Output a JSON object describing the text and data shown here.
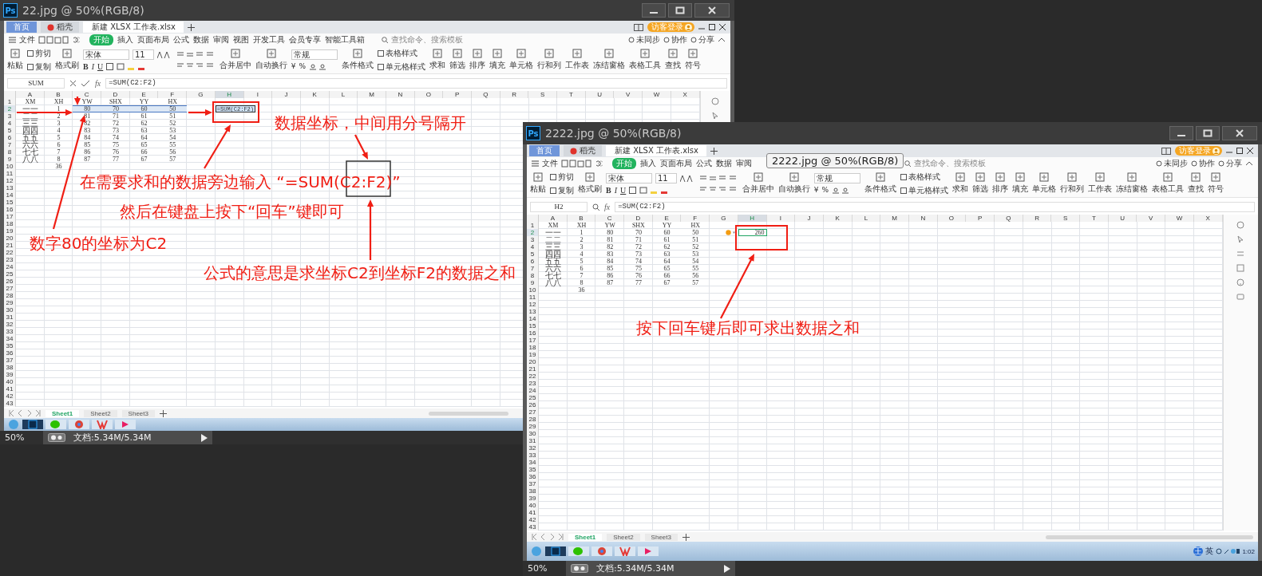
{
  "windows": [
    {
      "logo": "Ps",
      "title": "22.jpg @ 50%(RGB/8)",
      "zoom": "50%",
      "doc_info": "文档:5.34M/5.34M",
      "app": {
        "tabs": [
          {
            "label": "首页",
            "kind": "home",
            "selected": false
          },
          {
            "label": "稻壳",
            "kind": "docer",
            "selected": false
          },
          {
            "label": "新建 XLSX 工作表.xlsx",
            "kind": "file",
            "selected": true
          }
        ],
        "login": "访客登录",
        "file_menu": "文件",
        "menu": [
          {
            "label": "开始",
            "selected": true
          },
          {
            "label": "插入",
            "selected": false
          },
          {
            "label": "页面布局",
            "selected": false
          },
          {
            "label": "公式",
            "selected": false
          },
          {
            "label": "数据",
            "selected": false
          },
          {
            "label": "审阅",
            "selected": false
          },
          {
            "label": "视图",
            "selected": false
          },
          {
            "label": "开发工具",
            "selected": false
          },
          {
            "label": "会员专享",
            "selected": false
          },
          {
            "label": "智能工具箱",
            "selected": false
          }
        ],
        "search_placeholder": "查找命令、搜索模板",
        "actions": [
          "未同步",
          "协作",
          "分享"
        ],
        "ribbon": [
          {
            "kind": "big",
            "label": "粘贴"
          },
          {
            "kind": "pair",
            "labels": [
              "剪切",
              "复制"
            ]
          },
          {
            "kind": "big",
            "label": "格式刷"
          },
          {
            "kind": "font",
            "face": "宋体",
            "size": "11",
            "styles": [
              "B",
              "I",
              "U"
            ]
          },
          {
            "kind": "align"
          },
          {
            "kind": "big",
            "label": "合并居中"
          },
          {
            "kind": "big",
            "label": "自动换行"
          },
          {
            "kind": "number",
            "format": "常规",
            "symbols": [
              "¥",
              "%"
            ]
          },
          {
            "kind": "big",
            "label": "条件格式"
          },
          {
            "kind": "pair",
            "labels": [
              "表格样式",
              "单元格样式"
            ]
          },
          {
            "kind": "big",
            "label": "求和"
          },
          {
            "kind": "big",
            "label": "筛选"
          },
          {
            "kind": "big",
            "label": "排序"
          },
          {
            "kind": "big",
            "label": "填充"
          },
          {
            "kind": "big",
            "label": "单元格"
          },
          {
            "kind": "big",
            "label": "行和列"
          },
          {
            "kind": "big",
            "label": "工作表"
          },
          {
            "kind": "big",
            "label": "冻结窗格"
          },
          {
            "kind": "big",
            "label": "表格工具"
          },
          {
            "kind": "big",
            "label": "查找"
          },
          {
            "kind": "big",
            "label": "符号"
          }
        ],
        "formula_bar": {
          "kind": "editing",
          "name_box": "SUM",
          "fx": "fx",
          "formula": "=SUM(C2:F2)"
        },
        "columns": [
          "A",
          "B",
          "C",
          "D",
          "E",
          "F",
          "G",
          "H",
          "I",
          "J",
          "K",
          "L",
          "M",
          "N",
          "O",
          "P",
          "Q",
          "R",
          "S",
          "T",
          "U",
          "V",
          "W",
          "X"
        ],
        "rows": [
          {
            "number": "1",
            "cells": {
              "A": "XM",
              "B": "XH",
              "C": "YW",
              "D": "SHX",
              "E": "YY",
              "F": "HX"
            }
          },
          {
            "number": "2",
            "cells": {
              "A": "一一",
              "B": "1",
              "C": {
                "text": "80",
                "selected": true
              },
              "D": {
                "text": "70",
                "selected": true
              },
              "E": {
                "text": "60",
                "selected": true
              },
              "F": {
                "text": "50",
                "selected": true
              },
              "H": {
                "text": "=SUM(C2:F2)",
                "kind": "editing"
              }
            }
          },
          {
            "number": "3",
            "cells": {
              "A": "二二",
              "B": "2",
              "C": "81",
              "D": "71",
              "E": "61",
              "F": "51"
            }
          },
          {
            "number": "4",
            "cells": {
              "A": "三三",
              "B": "3",
              "C": "82",
              "D": "72",
              "E": "62",
              "F": "52"
            }
          },
          {
            "number": "5",
            "cells": {
              "A": "四四",
              "B": "4",
              "C": "83",
              "D": "73",
              "E": "63",
              "F": "53"
            }
          },
          {
            "number": "6",
            "cells": {
              "A": "五五",
              "B": "5",
              "C": "84",
              "D": "74",
              "E": "64",
              "F": "54"
            }
          },
          {
            "number": "7",
            "cells": {
              "A": "六六",
              "B": "6",
              "C": "85",
              "D": "75",
              "E": "65",
              "F": "55"
            }
          },
          {
            "number": "8",
            "cells": {
              "A": "七七",
              "B": "7",
              "C": "86",
              "D": "76",
              "E": "66",
              "F": "56"
            }
          },
          {
            "number": "9",
            "cells": {
              "A": "八八",
              "B": "8",
              "C": "87",
              "D": "77",
              "E": "67",
              "F": "57"
            }
          },
          {
            "number": "10",
            "cells": {
              "B": "36"
            }
          },
          {
            "number": "11"
          },
          {
            "number": "12"
          },
          {
            "number": "13"
          },
          {
            "number": "14"
          },
          {
            "number": "15"
          },
          {
            "number": "16"
          },
          {
            "number": "17"
          },
          {
            "number": "18"
          },
          {
            "number": "19"
          },
          {
            "number": "20"
          },
          {
            "number": "21"
          },
          {
            "number": "22"
          },
          {
            "number": "23"
          },
          {
            "number": "24"
          },
          {
            "number": "25"
          },
          {
            "number": "26"
          },
          {
            "number": "27"
          },
          {
            "number": "28"
          },
          {
            "number": "29"
          },
          {
            "number": "30"
          },
          {
            "number": "31"
          },
          {
            "number": "32"
          },
          {
            "number": "33"
          },
          {
            "number": "34"
          },
          {
            "number": "35"
          },
          {
            "number": "36"
          },
          {
            "number": "37"
          },
          {
            "number": "38"
          },
          {
            "number": "39"
          },
          {
            "number": "40"
          },
          {
            "number": "41"
          },
          {
            "number": "42"
          },
          {
            "number": "43"
          }
        ],
        "sheets": [
          {
            "label": "Sheet1",
            "selected": true
          },
          {
            "label": "Sheet2",
            "selected": false
          },
          {
            "label": "Sheet3",
            "selected": false
          }
        ]
      }
    },
    {
      "logo": "Ps",
      "title": "2222.jpg @ 50%(RGB/8)",
      "zoom": "50%",
      "doc_info": "文档:5.34M/5.34M",
      "app": {
        "tabs": [
          {
            "label": "首页",
            "kind": "home",
            "selected": false
          },
          {
            "label": "稻壳",
            "kind": "docer",
            "selected": false
          },
          {
            "label": "新建 XLSX 工作表.xlsx",
            "kind": "file",
            "selected": true
          }
        ],
        "login": "访客登录",
        "file_menu": "文件",
        "menu": [
          {
            "label": "开始",
            "selected": true
          },
          {
            "label": "插入",
            "selected": false
          },
          {
            "label": "页面布局",
            "selected": false
          },
          {
            "label": "公式",
            "selected": false
          },
          {
            "label": "数据",
            "selected": false
          },
          {
            "label": "审阅",
            "selected": false
          }
        ],
        "search_placeholder": "查找命令、搜索模板",
        "actions": [
          "未同步",
          "协作",
          "分享"
        ],
        "ribbon": [
          {
            "kind": "big",
            "label": "粘贴"
          },
          {
            "kind": "pair",
            "labels": [
              "剪切",
              "复制"
            ]
          },
          {
            "kind": "big",
            "label": "格式刷"
          },
          {
            "kind": "font",
            "face": "宋体",
            "size": "11",
            "styles": [
              "B",
              "I",
              "U"
            ]
          },
          {
            "kind": "align"
          },
          {
            "kind": "big",
            "label": "合并居中"
          },
          {
            "kind": "big",
            "label": "自动换行"
          },
          {
            "kind": "number",
            "format": "常规",
            "symbols": [
              "¥",
              "%"
            ]
          },
          {
            "kind": "big",
            "label": "条件格式"
          },
          {
            "kind": "pair",
            "labels": [
              "表格样式",
              "单元格样式"
            ]
          },
          {
            "kind": "big",
            "label": "求和"
          },
          {
            "kind": "big",
            "label": "筛选"
          },
          {
            "kind": "big",
            "label": "排序"
          },
          {
            "kind": "big",
            "label": "填充"
          },
          {
            "kind": "big",
            "label": "单元格"
          },
          {
            "kind": "big",
            "label": "行和列"
          },
          {
            "kind": "big",
            "label": "工作表"
          },
          {
            "kind": "big",
            "label": "冻结窗格"
          },
          {
            "kind": "big",
            "label": "表格工具"
          },
          {
            "kind": "big",
            "label": "查找"
          },
          {
            "kind": "big",
            "label": "符号"
          }
        ],
        "formula_bar": {
          "kind": "idle",
          "name_box": "H2",
          "fx": "fx",
          "formula": "=SUM(C2:F2)"
        },
        "columns": [
          "A",
          "B",
          "C",
          "D",
          "E",
          "F",
          "G",
          "H",
          "I",
          "J",
          "K",
          "L",
          "M",
          "N",
          "O",
          "P",
          "Q",
          "R",
          "S",
          "T",
          "U",
          "V",
          "W",
          "X"
        ],
        "rows": [
          {
            "number": "1",
            "cells": {
              "A": "XM",
              "B": "XH",
              "C": "YW",
              "D": "SHX",
              "E": "YY",
              "F": "HX"
            }
          },
          {
            "number": "2",
            "cells": {
              "A": "一一",
              "B": "1",
              "C": "80",
              "D": "70",
              "E": "60",
              "F": "50",
              "H": {
                "text": "260",
                "kind": "result"
              }
            }
          },
          {
            "number": "3",
            "cells": {
              "A": "二二",
              "B": "2",
              "C": "81",
              "D": "71",
              "E": "61",
              "F": "51"
            }
          },
          {
            "number": "4",
            "cells": {
              "A": "三三",
              "B": "3",
              "C": "82",
              "D": "72",
              "E": "62",
              "F": "52"
            }
          },
          {
            "number": "5",
            "cells": {
              "A": "四四",
              "B": "4",
              "C": "83",
              "D": "73",
              "E": "63",
              "F": "53"
            }
          },
          {
            "number": "6",
            "cells": {
              "A": "五五",
              "B": "5",
              "C": "84",
              "D": "74",
              "E": "64",
              "F": "54"
            }
          },
          {
            "number": "7",
            "cells": {
              "A": "六六",
              "B": "6",
              "C": "85",
              "D": "75",
              "E": "65",
              "F": "55"
            }
          },
          {
            "number": "8",
            "cells": {
              "A": "七七",
              "B": "7",
              "C": "86",
              "D": "76",
              "E": "66",
              "F": "56"
            }
          },
          {
            "number": "9",
            "cells": {
              "A": "八八",
              "B": "8",
              "C": "87",
              "D": "77",
              "E": "67",
              "F": "57"
            }
          },
          {
            "number": "10",
            "cells": {
              "B": "36"
            }
          },
          {
            "number": "11"
          },
          {
            "number": "12"
          },
          {
            "number": "13"
          },
          {
            "number": "14"
          },
          {
            "number": "15"
          },
          {
            "number": "16"
          },
          {
            "number": "17"
          },
          {
            "number": "18"
          },
          {
            "number": "19"
          },
          {
            "number": "20"
          },
          {
            "number": "21"
          },
          {
            "number": "22"
          },
          {
            "number": "23"
          },
          {
            "number": "24"
          },
          {
            "number": "25"
          },
          {
            "number": "26"
          },
          {
            "number": "27"
          },
          {
            "number": "28"
          },
          {
            "number": "29"
          },
          {
            "number": "30"
          },
          {
            "number": "31"
          },
          {
            "number": "32"
          },
          {
            "number": "33"
          },
          {
            "number": "34"
          },
          {
            "number": "35"
          },
          {
            "number": "36"
          },
          {
            "number": "37"
          },
          {
            "number": "38"
          },
          {
            "number": "39"
          },
          {
            "number": "40"
          },
          {
            "number": "41"
          },
          {
            "number": "42"
          },
          {
            "number": "43"
          }
        ],
        "sheets": [
          {
            "label": "Sheet1",
            "selected": true
          },
          {
            "label": "Sheet2",
            "selected": false
          },
          {
            "label": "Sheet3",
            "selected": false
          }
        ],
        "tray": [
          "王",
          "英",
          "1:02"
        ]
      }
    }
  ],
  "annotations": [
    {
      "kind": "note",
      "text": "数据坐标，中间用分号隔开"
    },
    {
      "kind": "note",
      "text": "在需要求和的数据旁边输入 “=SUM(C2:F2)”"
    },
    {
      "kind": "note",
      "text": "然后在键盘上按下“回车”键即可"
    },
    {
      "kind": "note",
      "text": "数字80的坐标为C2"
    },
    {
      "kind": "note",
      "text": "公式的意思是求坐标C2到坐标F2的数据之和"
    },
    {
      "kind": "note",
      "text": "按下回车键后即可求出数据之和"
    }
  ],
  "tooltip": "2222.jpg @ 50%(RGB/8)"
}
